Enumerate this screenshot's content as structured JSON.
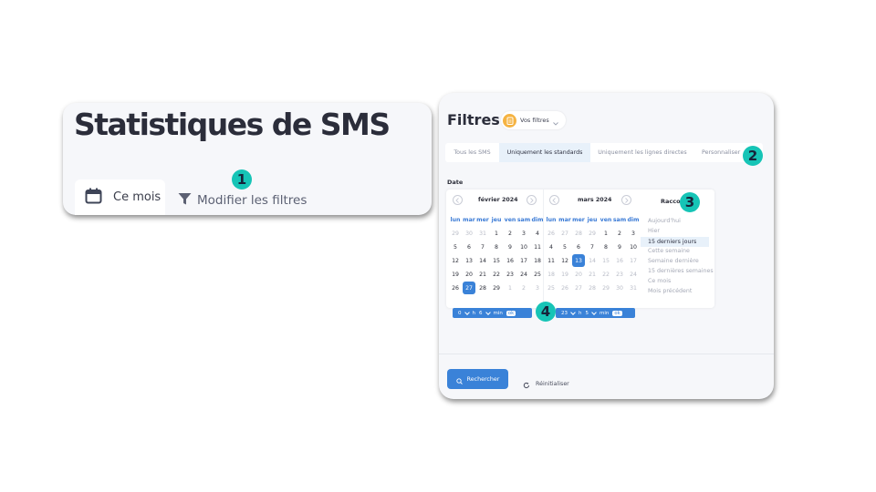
{
  "left_panel": {
    "title": "Statistiques de SMS",
    "period_tab": "Ce mois",
    "modify_filters": "Modifier les filtres",
    "icons": [
      "calendar-icon",
      "filter-icon"
    ]
  },
  "right_panel": {
    "title": "Filtres",
    "saved_filters": "Vos filtres",
    "tabs": [
      {
        "label": "Tous les SMS",
        "active": false
      },
      {
        "label": "Uniquement les standards",
        "active": true
      },
      {
        "label": "Uniquement les lignes directes",
        "active": false
      },
      {
        "label": "Personnaliser",
        "active": false
      }
    ],
    "date_label": "Date",
    "weekdays": [
      "lun",
      "mar",
      "mer",
      "jeu",
      "ven",
      "sam",
      "dim"
    ],
    "months": [
      {
        "title": "février 2024",
        "weeks": [
          [
            "29",
            "30",
            "31",
            "1",
            "2",
            "3",
            "4"
          ],
          [
            "5",
            "6",
            "7",
            "8",
            "9",
            "10",
            "11"
          ],
          [
            "12",
            "13",
            "14",
            "15",
            "16",
            "17",
            "18"
          ],
          [
            "19",
            "20",
            "21",
            "22",
            "23",
            "24",
            "25"
          ],
          [
            "26",
            "27",
            "28",
            "29",
            "1",
            "2",
            "3"
          ]
        ],
        "other_month": [
          [
            0,
            0
          ],
          [
            0,
            1
          ],
          [
            0,
            2
          ],
          [
            4,
            4
          ],
          [
            4,
            5
          ],
          [
            4,
            6
          ]
        ],
        "selected": [
          4,
          1
        ],
        "muted": []
      },
      {
        "title": "mars 2024",
        "weeks": [
          [
            "26",
            "27",
            "28",
            "29",
            "1",
            "2",
            "3"
          ],
          [
            "4",
            "5",
            "6",
            "7",
            "8",
            "9",
            "10"
          ],
          [
            "11",
            "12",
            "13",
            "14",
            "15",
            "16",
            "17"
          ],
          [
            "18",
            "19",
            "20",
            "21",
            "22",
            "23",
            "24"
          ],
          [
            "25",
            "26",
            "27",
            "28",
            "29",
            "30",
            "31"
          ]
        ],
        "other_month": [
          [
            0,
            0
          ],
          [
            0,
            1
          ],
          [
            0,
            2
          ],
          [
            0,
            3
          ]
        ],
        "selected": [
          2,
          2
        ],
        "muted_after_selected": true
      }
    ],
    "shortcuts": {
      "title": "Raccourcis",
      "items": [
        {
          "label": "Aujourd'hui",
          "active": false
        },
        {
          "label": "Hier",
          "active": false
        },
        {
          "label": "15 derniers jours",
          "active": true
        },
        {
          "label": "Cette semaine",
          "active": false
        },
        {
          "label": "Semaine dernière",
          "active": false
        },
        {
          "label": "15 dernières semaines",
          "active": false
        },
        {
          "label": "Ce mois",
          "active": false
        },
        {
          "label": "Mois précédent",
          "active": false
        }
      ]
    },
    "start_time": {
      "hours": "0",
      "h_label": "h",
      "minutes": "6",
      "min_label": "min",
      "ok": "ok"
    },
    "end_time": {
      "hours": "23",
      "h_label": "h",
      "minutes": "5",
      "min_label": "min",
      "ok": "ok"
    },
    "search_button": "Rechercher",
    "reset_button": "Réinitialiser"
  },
  "markers": [
    "1",
    "2",
    "3",
    "4"
  ],
  "colors": {
    "accent": "#3a82d8",
    "marker": "#16c4b6",
    "active_tab_bg": "#e8f1fa",
    "badge_orange": "#f5b342"
  }
}
